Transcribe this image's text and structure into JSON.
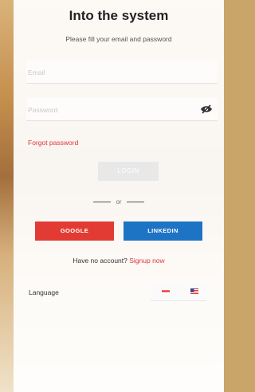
{
  "header": {
    "title": "Into the system",
    "subtitle": "Please fill your email and password"
  },
  "form": {
    "email_placeholder": "Email",
    "password_placeholder": "Password",
    "forgot_label": "Forgot password",
    "login_label": "LOGIN"
  },
  "social": {
    "or_label": "or",
    "google_label": "GOOGLE",
    "linkedin_label": "LINKEDIN",
    "google_color": "#e23b33",
    "linkedin_color": "#1d73c4"
  },
  "signup": {
    "prompt": "Have no account? ",
    "link": "Signup now"
  },
  "language": {
    "label": "Language",
    "options": [
      "ru-flag-icon",
      "en-flag-icon"
    ]
  },
  "colors": {
    "accent": "#e0353b"
  }
}
